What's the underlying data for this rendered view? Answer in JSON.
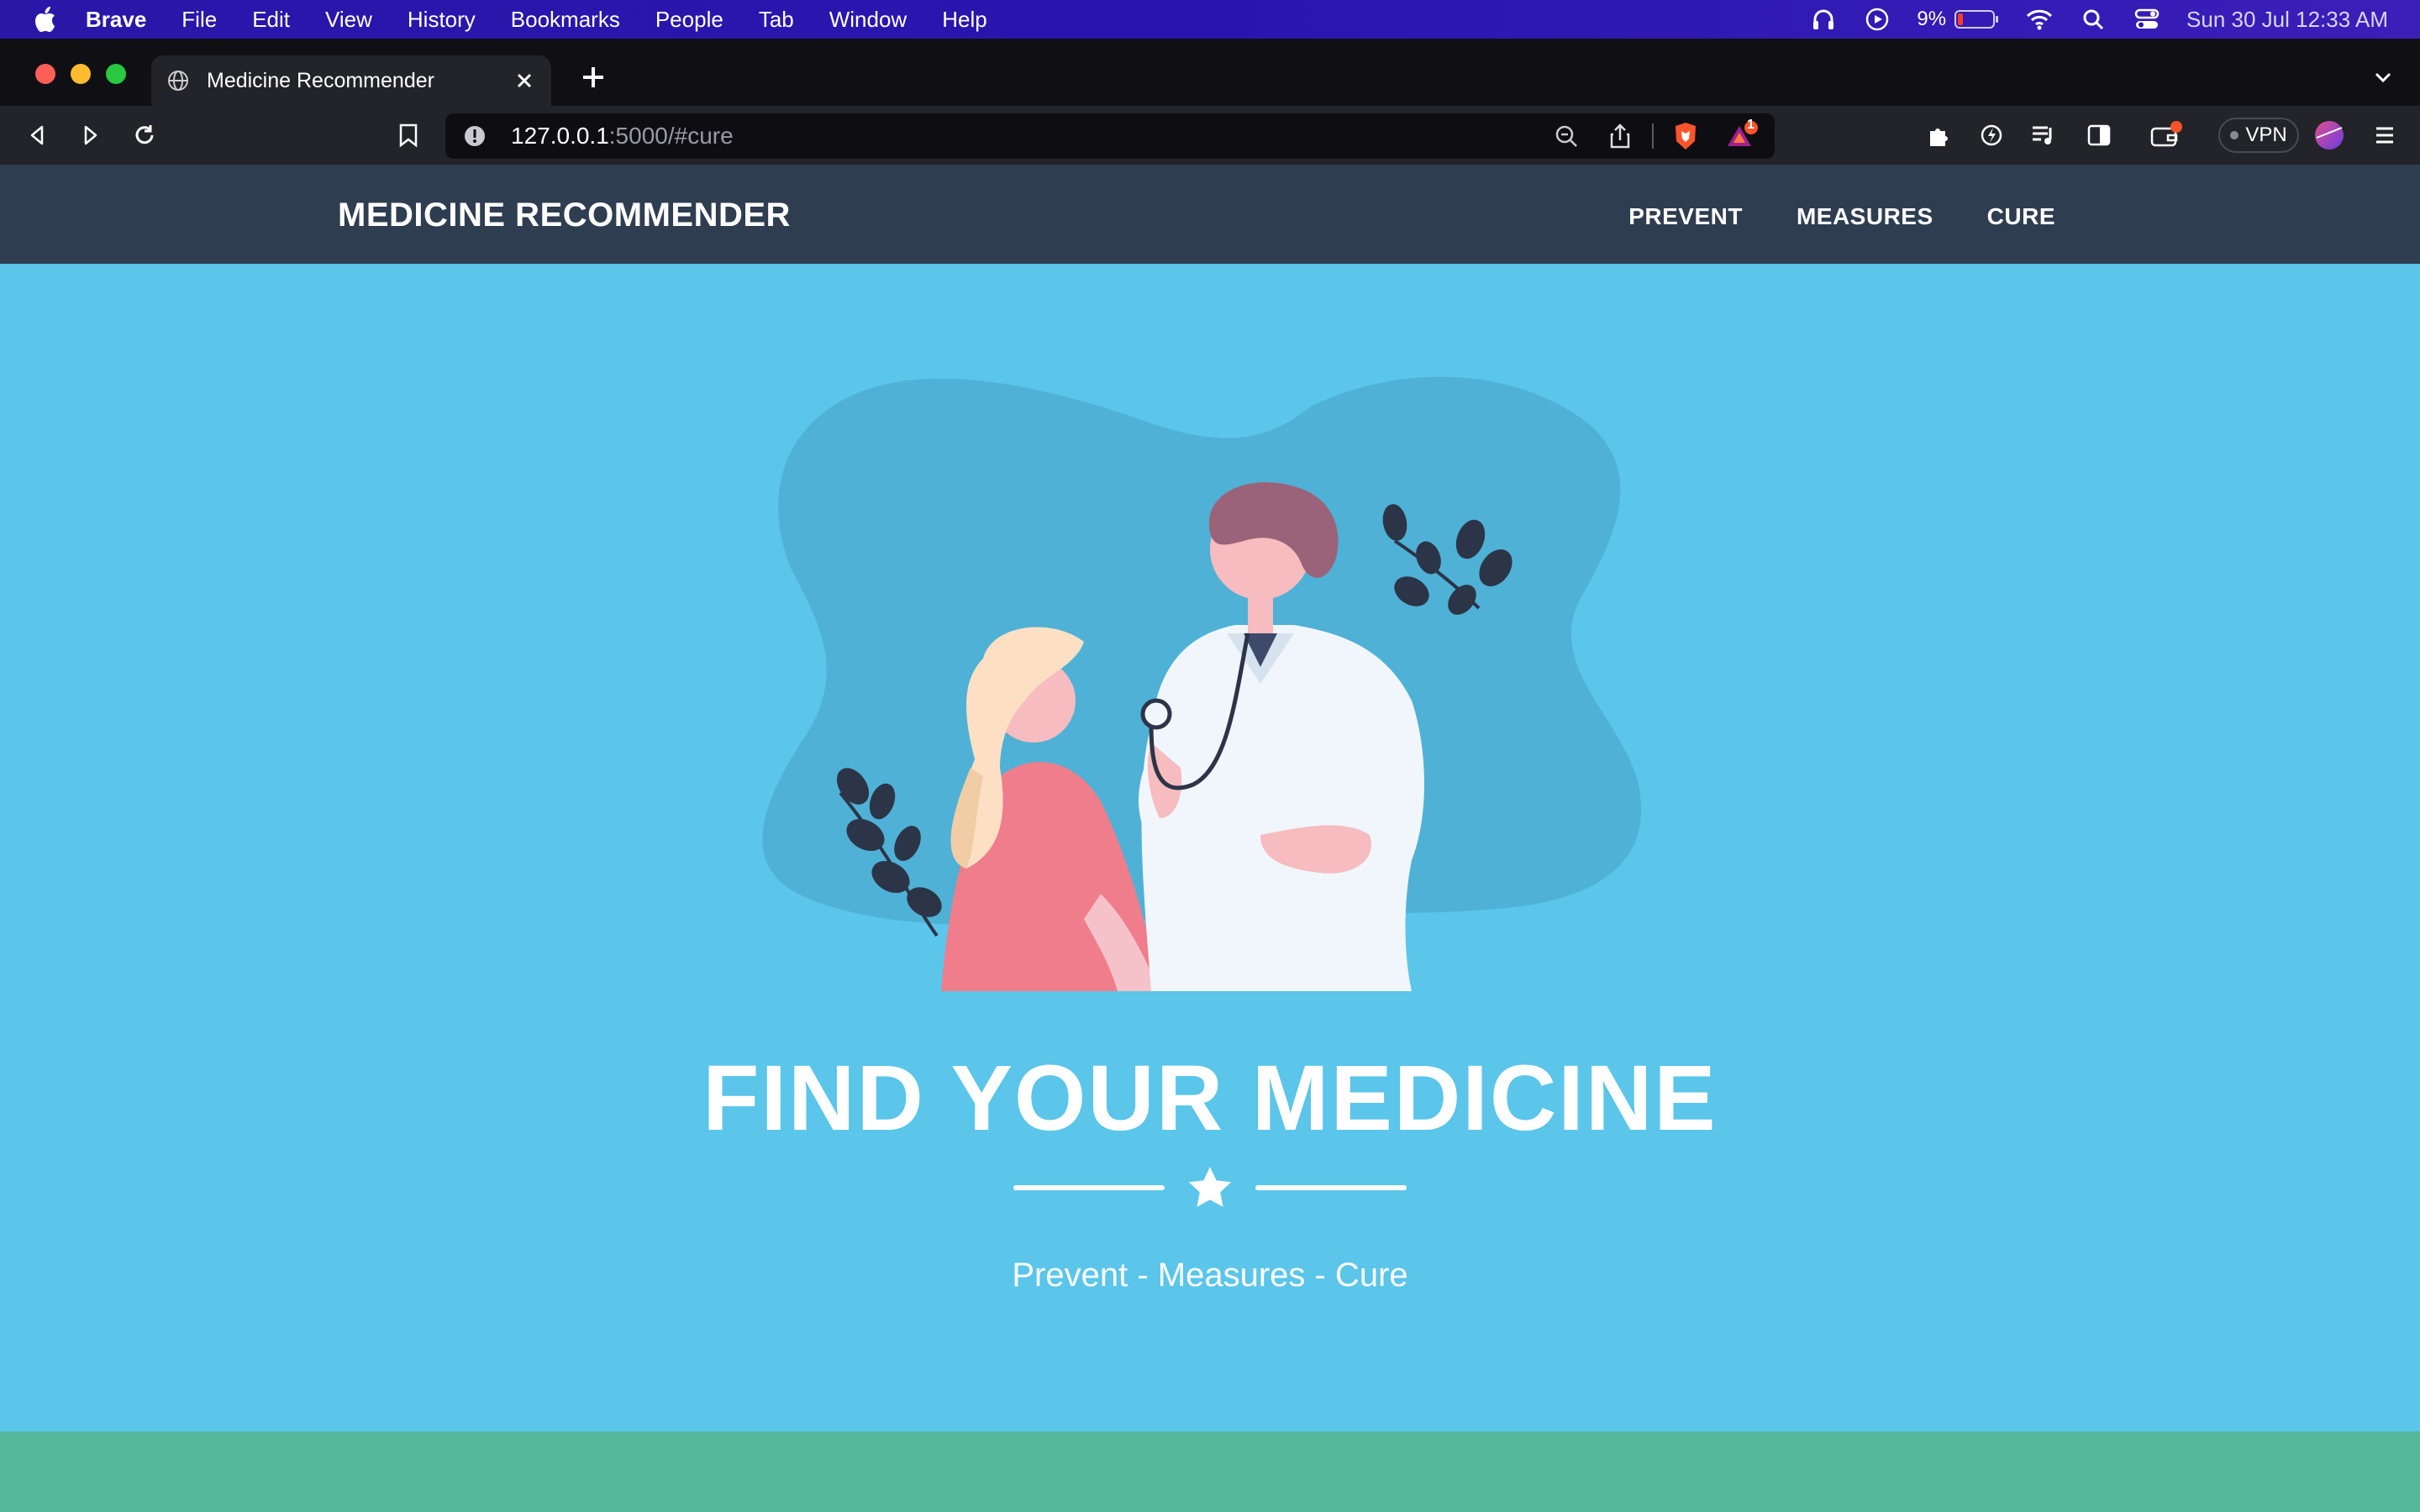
{
  "menubar": {
    "app_name": "Brave",
    "items": [
      "File",
      "Edit",
      "View",
      "History",
      "Bookmarks",
      "People",
      "Tab",
      "Window",
      "Help"
    ],
    "battery_percent": "9%",
    "clock": "Sun 30 Jul  12:33 AM"
  },
  "browser": {
    "tab_title": "Medicine Recommender",
    "url_host": "127.0.0.1",
    "url_rest": ":5000/#cure",
    "rewards_badge": "1",
    "vpn_label": "VPN"
  },
  "site": {
    "brand": "MEDICINE RECOMMENDER",
    "nav": [
      "PREVENT",
      "MEASURES",
      "CURE"
    ],
    "hero_title": "FIND YOUR MEDICINE",
    "hero_subtitle": "Prevent - Measures - Cure"
  },
  "colors": {
    "menubar": "#2a17a8",
    "navbar": "#2f3d50",
    "hero_bg": "#5bc5ea",
    "bottom_strip": "#55b79a"
  },
  "icons": [
    "apple-icon",
    "headphones-icon",
    "play-icon",
    "battery-icon",
    "wifi-icon",
    "search-icon",
    "control-center-icon",
    "globe-icon",
    "close-icon",
    "plus-icon",
    "back-icon",
    "forward-icon",
    "reload-icon",
    "bookmark-icon",
    "info-icon",
    "zoom-out-icon",
    "share-icon",
    "brave-shields-icon",
    "brave-rewards-icon",
    "extensions-icon",
    "speedreader-icon",
    "playlist-icon",
    "sidebar-icon",
    "wallet-icon",
    "profile-icon",
    "menu-icon",
    "star-icon"
  ]
}
